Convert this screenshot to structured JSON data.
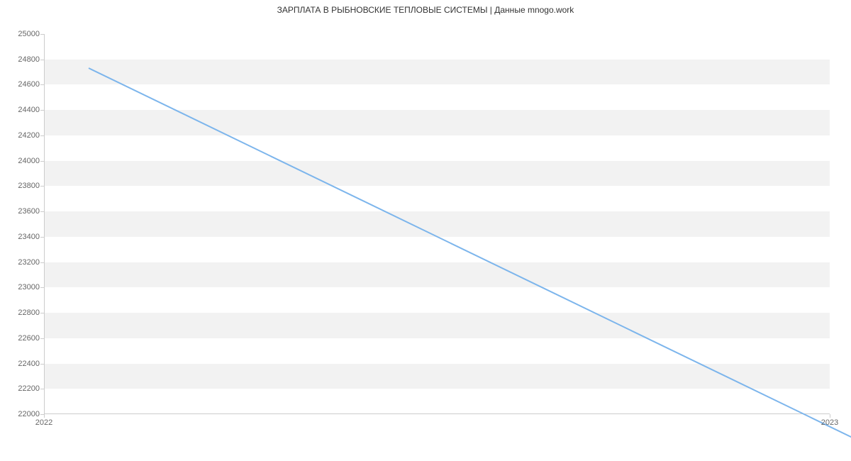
{
  "chart_data": {
    "type": "line",
    "title": "ЗАРПЛАТА В РЫБНОВСКИЕ ТЕПЛОВЫЕ СИСТЕМЫ | Данные mnogo.work",
    "x": [
      2022,
      2023
    ],
    "values": [
      25000,
      22000
    ],
    "xlabel": "",
    "ylabel": "",
    "xlim": [
      2022,
      2023
    ],
    "ylim": [
      22000,
      25000
    ],
    "y_ticks": [
      22000,
      22200,
      22400,
      22600,
      22800,
      23000,
      23200,
      23400,
      23600,
      23800,
      24000,
      24200,
      24400,
      24600,
      24800,
      25000
    ],
    "x_ticks": [
      2022,
      2023
    ],
    "grid": true,
    "line_color": "#7cb5ec",
    "band_color": "#f2f2f2"
  }
}
